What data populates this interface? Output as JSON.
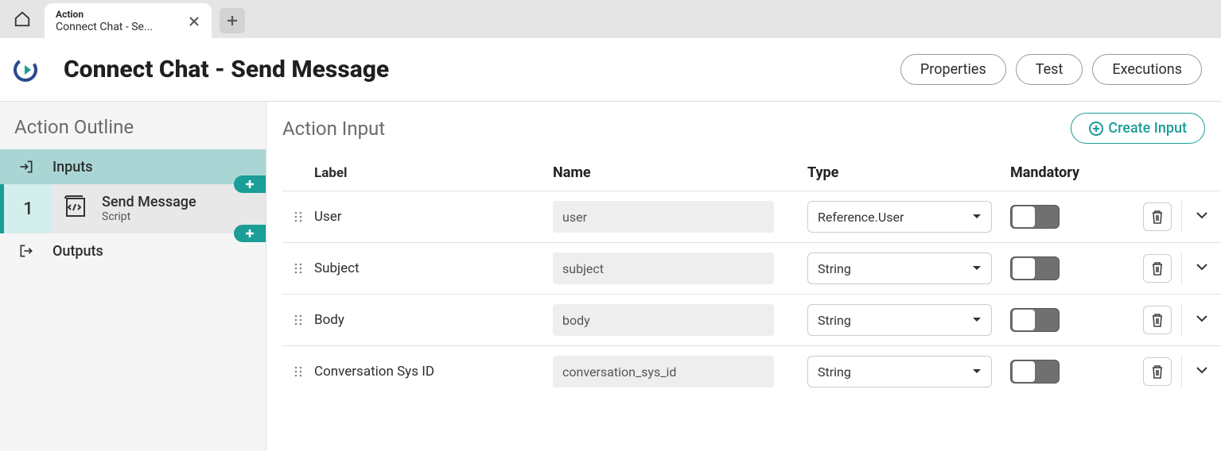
{
  "topbar": {
    "tab": {
      "category": "Action",
      "title": "Connect Chat - Se..."
    }
  },
  "header": {
    "title": "Connect Chat - Send Message",
    "buttons": {
      "properties": "Properties",
      "test": "Test",
      "executions": "Executions"
    }
  },
  "sidebar": {
    "title": "Action Outline",
    "inputs_label": "Inputs",
    "outputs_label": "Outputs",
    "step": {
      "number": "1",
      "title": "Send Message",
      "subtitle": "Script"
    }
  },
  "main": {
    "title": "Action Input",
    "create_label": "Create Input",
    "columns": {
      "label": "Label",
      "name": "Name",
      "type": "Type",
      "mandatory": "Mandatory"
    },
    "rows": [
      {
        "label": "User",
        "name": "user",
        "type": "Reference.User",
        "mandatory": false
      },
      {
        "label": "Subject",
        "name": "subject",
        "type": "String",
        "mandatory": false
      },
      {
        "label": "Body",
        "name": "body",
        "type": "String",
        "mandatory": false
      },
      {
        "label": "Conversation Sys ID",
        "name": "conversation_sys_id",
        "type": "String",
        "mandatory": false
      }
    ]
  }
}
